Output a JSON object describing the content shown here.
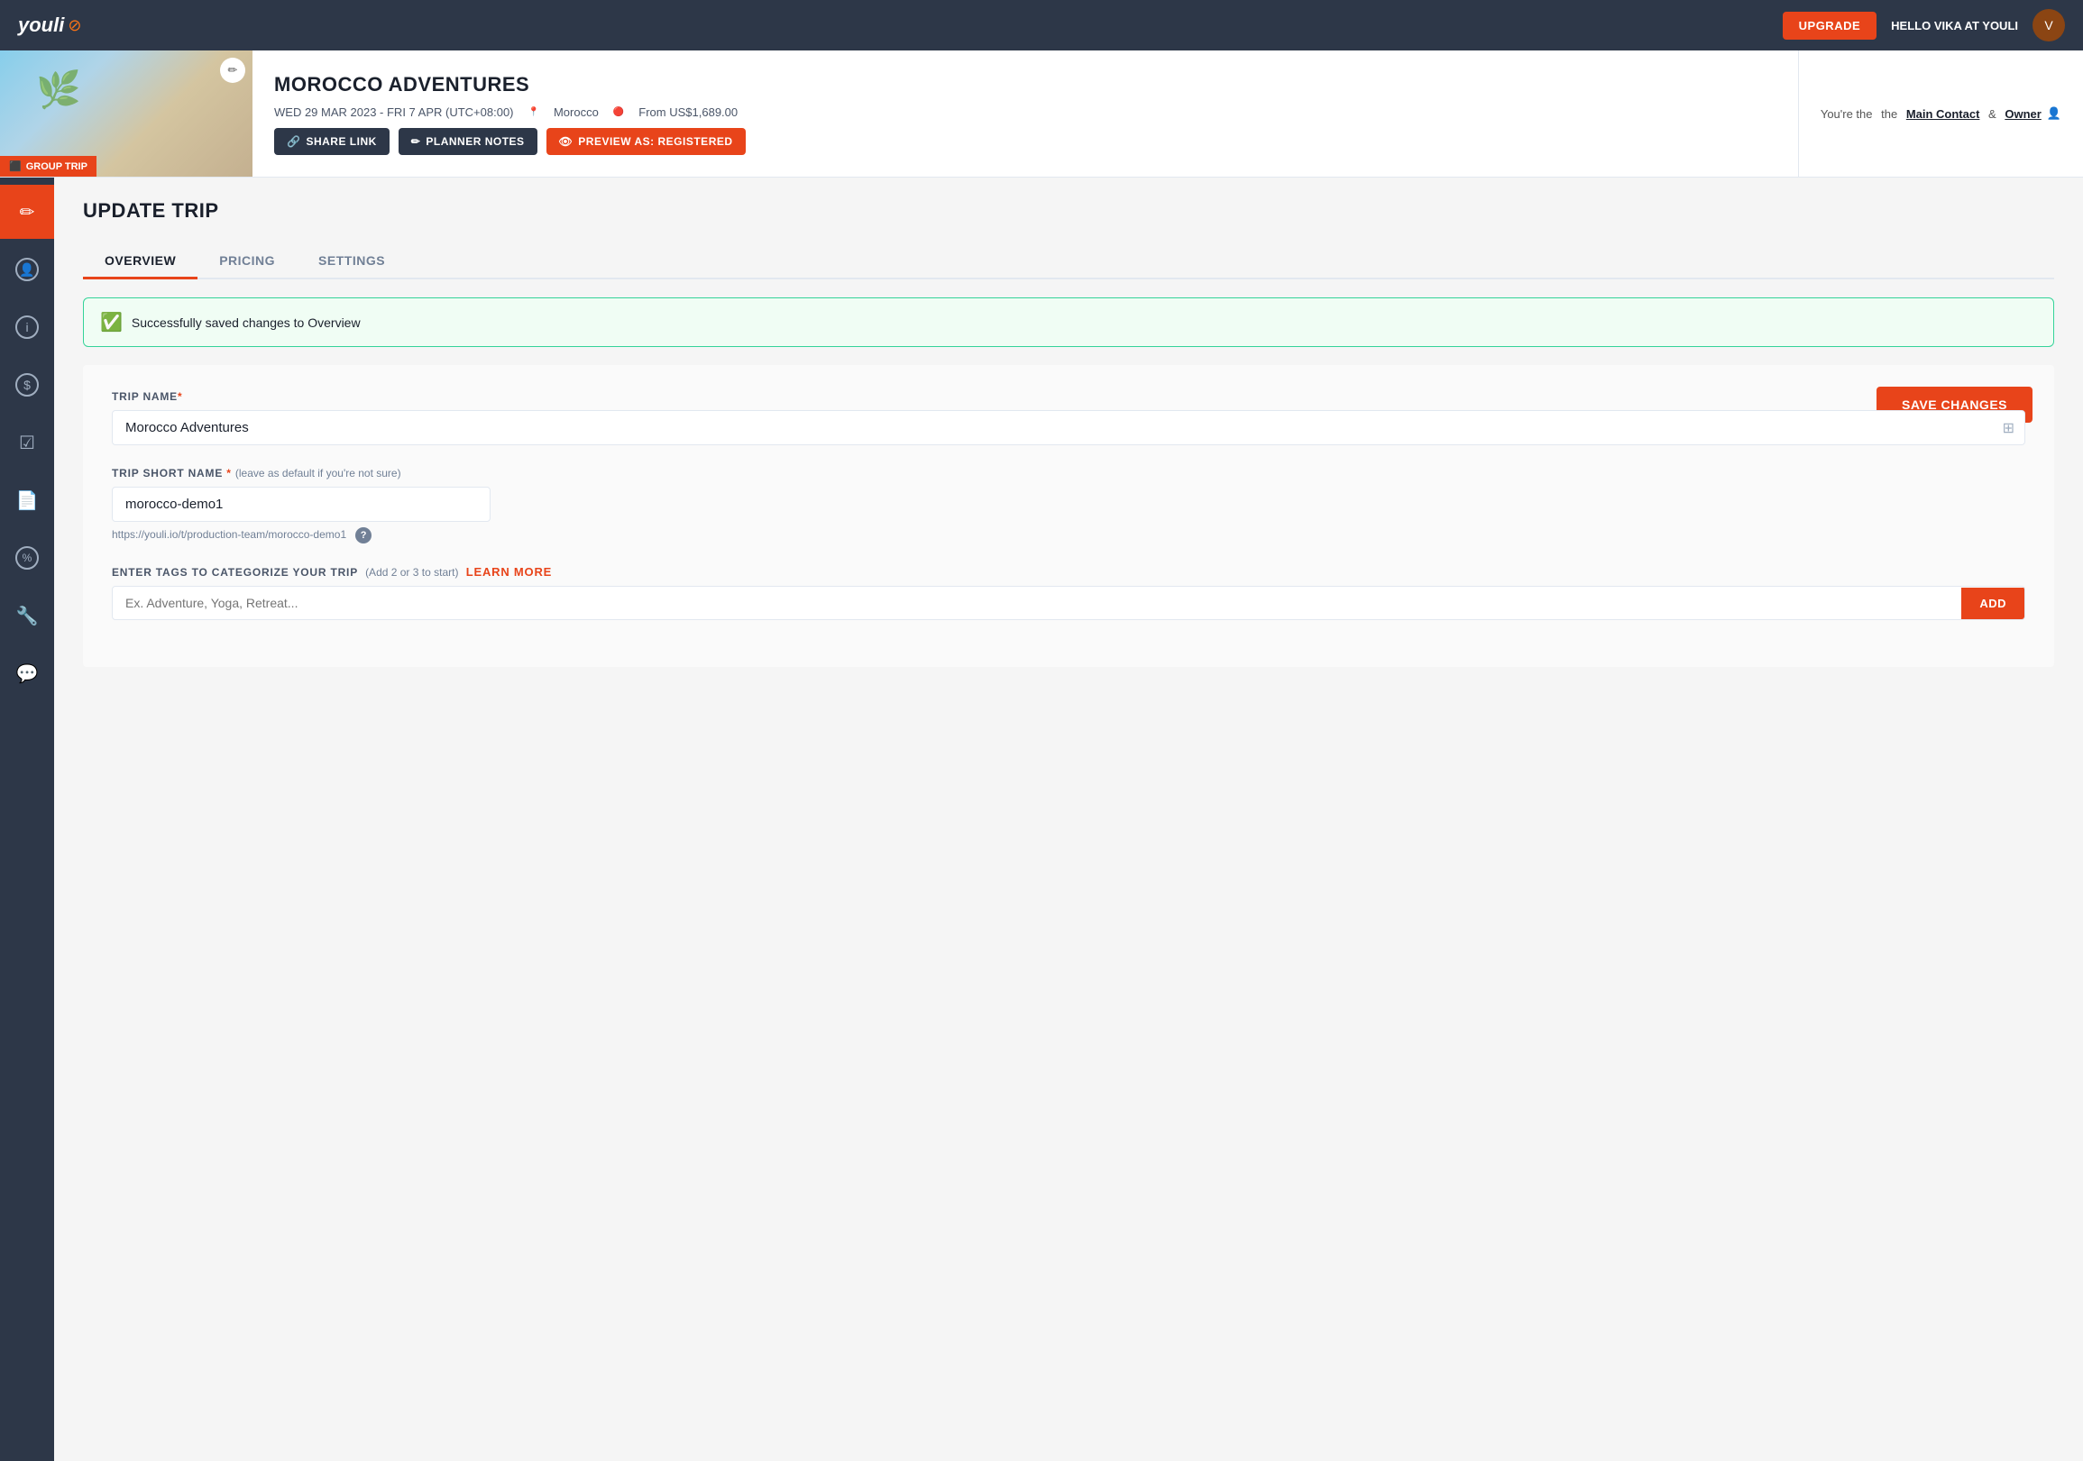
{
  "navbar": {
    "logo": "youli",
    "upgrade_label": "UPGRADE",
    "user_greeting": "HELLO VIKA AT YOULI"
  },
  "trip_header": {
    "title": "MOROCCO ADVENTURES",
    "dates": "WED 29 MAR 2023 - FRI 7 APR (UTC+08:00)",
    "location": "Morocco",
    "price": "From US$1,689.00",
    "group_trip_label": "GROUP TRIP",
    "owner_text_pre": "You're the",
    "main_contact_label": "Main Contact",
    "owner_label": "Owner",
    "actions": {
      "share_label": "SHARE LINK",
      "planner_notes_label": "PLANNER NOTES",
      "preview_label": "PREVIEW AS: REGISTERED"
    }
  },
  "sidebar": {
    "items": [
      {
        "name": "edit-icon",
        "symbol": "✏",
        "active": true
      },
      {
        "name": "person-icon",
        "symbol": "👤",
        "active": false
      },
      {
        "name": "info-icon",
        "symbol": "ⓘ",
        "active": false
      },
      {
        "name": "dollar-icon",
        "symbol": "$",
        "active": false
      },
      {
        "name": "checklist-icon",
        "symbol": "☑",
        "active": false
      },
      {
        "name": "doc-icon",
        "symbol": "📄",
        "active": false
      },
      {
        "name": "discount-icon",
        "symbol": "%",
        "active": false
      },
      {
        "name": "wrench-icon",
        "symbol": "🔧",
        "active": false
      },
      {
        "name": "chat-icon",
        "symbol": "💬",
        "active": false
      }
    ]
  },
  "page": {
    "title": "UPDATE TRIP",
    "tabs": [
      {
        "label": "OVERVIEW",
        "active": true
      },
      {
        "label": "PRICING",
        "active": false
      },
      {
        "label": "SETTINGS",
        "active": false
      }
    ],
    "success_message": "Successfully saved changes to Overview",
    "save_changes_label": "SAVE CHANGES",
    "form": {
      "trip_name_label": "TRIP NAME",
      "trip_name_required": "*",
      "trip_name_value": "Morocco Adventures",
      "trip_short_name_label": "TRIP SHORT NAME",
      "trip_short_name_hint": "(leave as default if you're not sure)",
      "trip_short_name_value": "morocco-demo1",
      "trip_url": "https://youli.io/t/production-team/morocco-demo1",
      "tags_label": "ENTER TAGS TO CATEGORIZE YOUR TRIP",
      "tags_hint": "(Add 2 or 3 to start)",
      "tags_learn_more": "Learn More",
      "tags_placeholder": "Ex. Adventure, Yoga, Retreat...",
      "add_tag_label": "ADD"
    }
  }
}
